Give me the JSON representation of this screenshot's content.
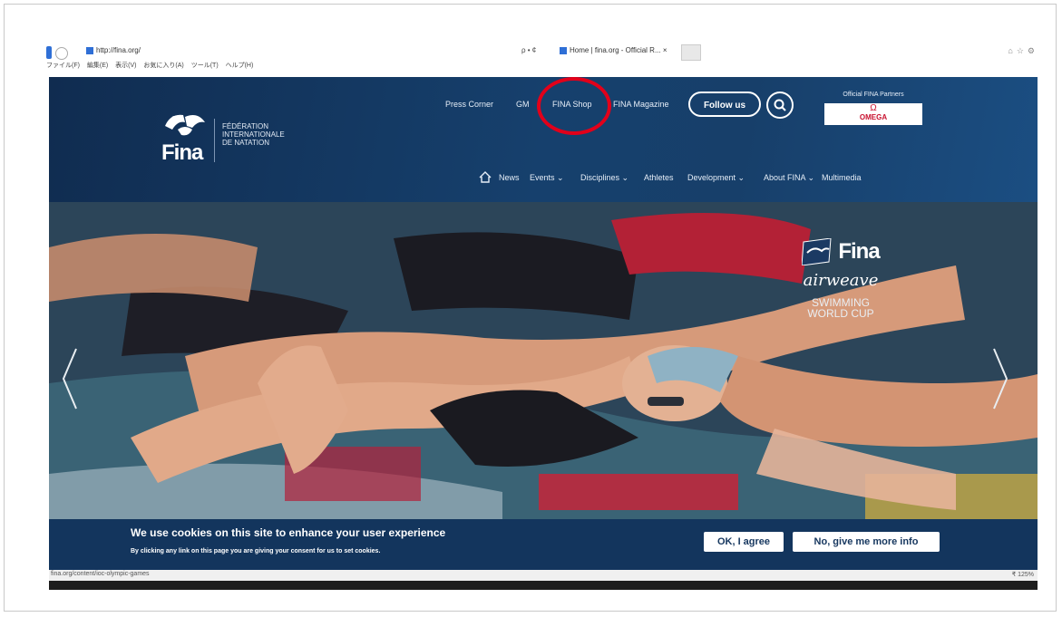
{
  "browser": {
    "url": "http://fina.org/",
    "tab_controls": "ρ • ¢",
    "tab_title": "Home | fina.org - Official R... ×",
    "window_icons": "⌂☆⚙",
    "menubar": "ファイル(F) 編集(E) 表示(V) お気に入り(A) ツール(T) ヘルプ(H)",
    "status_url": "fina.org/content/ioc-olympic-games",
    "zoom": "₹ 125%"
  },
  "header": {
    "logo_text": "Fina",
    "org_name_line1": "FÉDÉRATION",
    "org_name_line2": "INTERNATIONALE",
    "org_name_line3": "DE NATATION",
    "top_links": {
      "press": "Press Corner",
      "gm": "GM",
      "shop": "FINA Shop",
      "magazine": "FINA Magazine"
    },
    "follow_label": "Follow us",
    "partners_label": "Official FINA Partners",
    "partner_name": "OMEGA",
    "partner_symbol": "Ω"
  },
  "main_nav": {
    "news": "News",
    "events": "Events ⌄",
    "disciplines": "Disciplines ⌄",
    "athletes": "Athletes",
    "development": "Development ⌄",
    "about": "About FINA ⌄",
    "multimedia": "Multimedia"
  },
  "hero": {
    "brand_fina": "Fina",
    "brand_airweave": "airweave",
    "brand_line1": "SWIMMING",
    "brand_line2": "WORLD CUP"
  },
  "cookie": {
    "title": "We use cookies on this site to enhance your user experience",
    "body": "By clicking any link on this page you are giving your consent for us to set cookies.",
    "agree_label": "OK, I agree",
    "info_label": "No, give me more info"
  },
  "colors": {
    "header_navy": "#13355d",
    "highlight_red": "#e2001a",
    "omega_red": "#c8102e"
  }
}
